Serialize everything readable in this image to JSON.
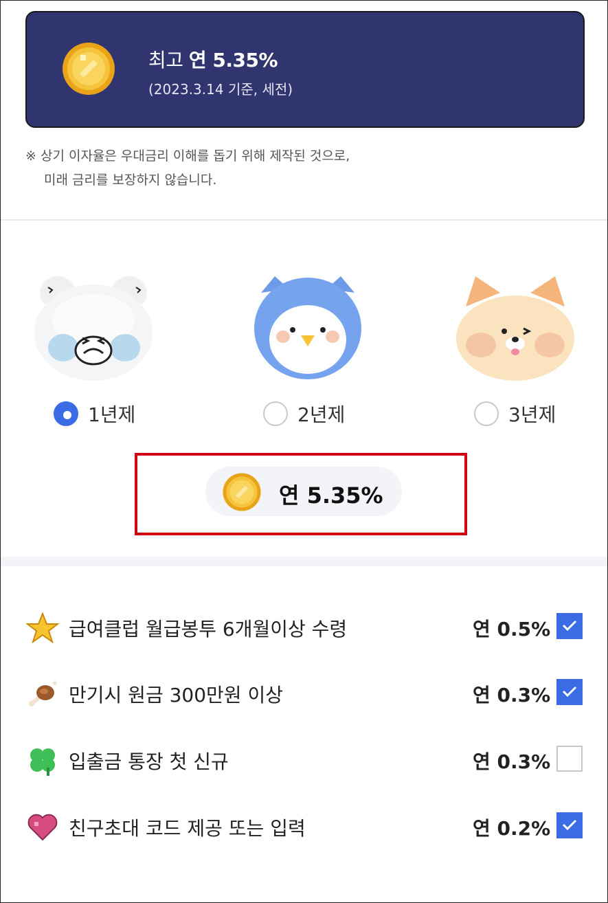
{
  "banner": {
    "title_prefix": "최고 ",
    "title_rate": "연 5.35%",
    "subtitle": "(2023.3.14 기준, 세전)",
    "coin_icon": "gold-coin-icon",
    "background": "#303570"
  },
  "notice": {
    "line1": "※ 상기 이자율은 우대금리 이해를 돕기 위해 제작된 것으로,",
    "line2": "미래 금리를 보장하지 않습니다."
  },
  "terms": [
    {
      "label": "1년제",
      "character": "bear",
      "selected": true
    },
    {
      "label": "2년제",
      "character": "bird",
      "selected": false
    },
    {
      "label": "3년제",
      "character": "cat",
      "selected": false
    }
  ],
  "selected_rate": "연 5.35%",
  "conditions": [
    {
      "icon": "star-icon",
      "label": "급여클럽 월급봉투 6개월이상 수령",
      "rate": "연 0.5%",
      "checked": true
    },
    {
      "icon": "meat-icon",
      "label": "만기시 원금 300만원 이상",
      "rate": "연 0.3%",
      "checked": true
    },
    {
      "icon": "clover-icon",
      "label": "입출금 통장 첫 신규",
      "rate": "연 0.3%",
      "checked": false
    },
    {
      "icon": "heart-icon",
      "label": "친구초대 코드 제공 또는 입력",
      "rate": "연 0.2%",
      "checked": true
    }
  ],
  "colors": {
    "accent": "#3b6ce6",
    "highlight": "#d10010",
    "banner": "#303570"
  }
}
